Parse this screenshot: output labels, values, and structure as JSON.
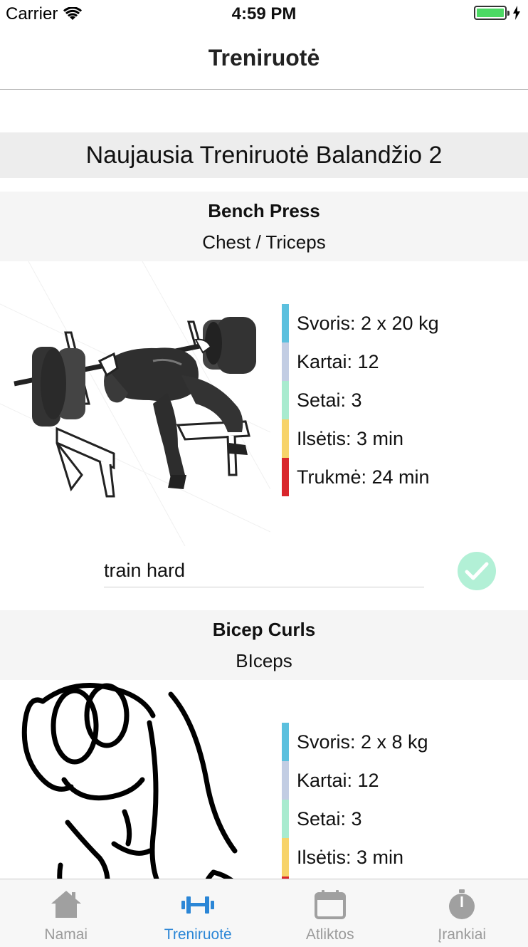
{
  "status_bar": {
    "carrier": "Carrier",
    "time": "4:59 PM",
    "icons": [
      "wifi-icon",
      "battery-icon",
      "charging-bolt-icon"
    ]
  },
  "nav": {
    "title": "Treniruotė"
  },
  "workout": {
    "title": "Naujausia Treniruotė Balandžio 2"
  },
  "stat_colors": {
    "weight": "#5bc0de",
    "reps": "#c2cde3",
    "sets": "#a8ebcf",
    "rest": "#f7d36a",
    "duration": "#d9262c"
  },
  "exercises": [
    {
      "name": "Bench Press",
      "muscle": "Chest / Triceps",
      "image": "bench-press-illustration",
      "stats": {
        "weight": "Svoris: 2 x 20 kg",
        "reps": "Kartai: 12",
        "sets": "Setai: 3",
        "rest": "Ilsėtis: 3 min",
        "duration": "Trukmė: 24 min"
      },
      "note": "train hard"
    },
    {
      "name": "Bicep Curls",
      "muscle": "BIceps",
      "image": "bicep-curl-illustration",
      "stats": {
        "weight": "Svoris: 2 x 8 kg",
        "reps": "Kartai: 12",
        "sets": "Setai: 3",
        "rest": "Ilsėtis: 3 min"
      }
    }
  ],
  "tabs": [
    {
      "label": "Namai",
      "icon": "home-icon",
      "active": false
    },
    {
      "label": "Treniruotė",
      "icon": "dumbbell-icon",
      "active": true
    },
    {
      "label": "Atliktos",
      "icon": "calendar-icon",
      "active": false
    },
    {
      "label": "Įrankiai",
      "icon": "stopwatch-icon",
      "active": false
    }
  ],
  "colors": {
    "tab_active": "#2b86d6",
    "tab_inactive": "#9a9a9a",
    "check": "#b2f0d6"
  }
}
